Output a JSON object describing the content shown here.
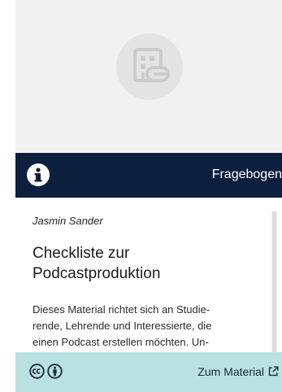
{
  "card": {
    "thumbnail": {
      "icon": "questionnaire-icon"
    },
    "type_bar": {
      "info_icon": "info-icon",
      "type_label": "Fragebogen"
    },
    "author": "Jasmin Sander",
    "title": "Checkliste zur Podcastproduktion",
    "description_lines": [
      "Dieses Material richtet sich an Studie-",
      "rende, Lehrende und Interessierte, die",
      "einen Podcast erstellen möchten. Un-"
    ],
    "footer": {
      "license_icons": [
        "cc-icon",
        "by-attribution-icon"
      ],
      "link_label": "Zum Material",
      "link_icon": "external-link-icon"
    },
    "colors": {
      "type_bar_bg": "#0d1f3f",
      "footer_bg": "#b9e1e2",
      "thumbnail_bg": "#f1f1f1"
    }
  }
}
